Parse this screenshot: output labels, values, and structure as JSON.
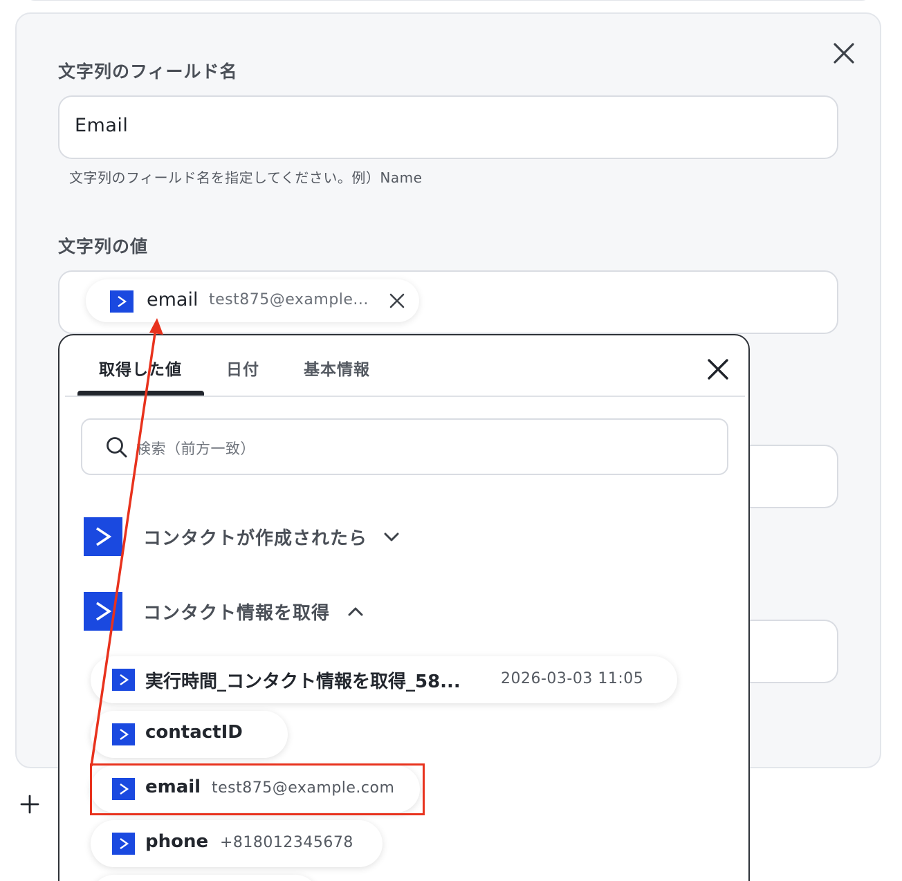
{
  "panel": {
    "name_field_label": "文字列のフィールド名",
    "name_field_value": "Email",
    "name_field_helper": "文字列のフィールド名を指定してください。例）Name",
    "value_field_label": "文字列の値"
  },
  "selected_chip": {
    "icon": "activecampaign-icon",
    "key": "email",
    "value": "test875@example..."
  },
  "dropdown": {
    "tabs": [
      {
        "label": "取得した値",
        "active": true
      },
      {
        "label": "日付",
        "active": false
      },
      {
        "label": "基本情報",
        "active": false
      }
    ],
    "search_placeholder": "検索（前方一致）",
    "sections": [
      {
        "label": "コンタクトが作成されたら",
        "expanded": false
      },
      {
        "label": "コンタクト情報を取得",
        "expanded": true
      }
    ],
    "items": [
      {
        "key": "実行時間_コンタクト情報を取得_58...",
        "value": "2026-03-03 11:05"
      },
      {
        "key": "contactID",
        "value": ""
      },
      {
        "key": "email",
        "value": "test875@example.com"
      },
      {
        "key": "phone",
        "value": "+818012345678"
      }
    ]
  },
  "colors": {
    "brand": "#1a49e0",
    "annotation": "#e8321d"
  }
}
